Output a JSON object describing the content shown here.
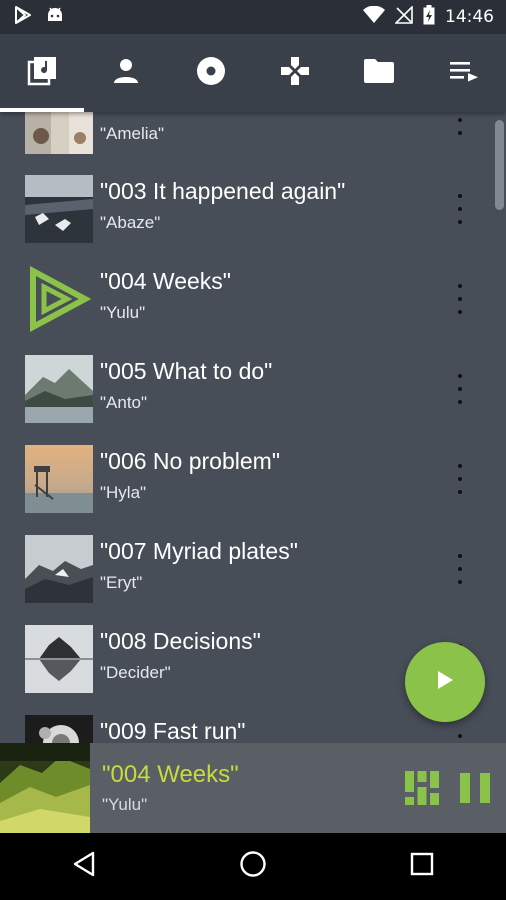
{
  "status_bar": {
    "time": "14:46"
  },
  "tabs": [
    {
      "name": "tracks",
      "icon": "music-library-icon",
      "active": true
    },
    {
      "name": "artists",
      "icon": "person-icon",
      "active": false
    },
    {
      "name": "albums",
      "icon": "disc-icon",
      "active": false
    },
    {
      "name": "genres",
      "icon": "gamepad-icon",
      "active": false
    },
    {
      "name": "folders",
      "icon": "folder-icon",
      "active": false
    },
    {
      "name": "playlists",
      "icon": "playlist-icon",
      "active": false
    }
  ],
  "tracks": [
    {
      "title": "",
      "artist": "\"Amelia\""
    },
    {
      "title": "\"003 It happened again\"",
      "artist": "\"Abaze\""
    },
    {
      "title": "\"004 Weeks\"",
      "artist": "\"Yulu\""
    },
    {
      "title": "\"005 What to do\"",
      "artist": "\"Anto\""
    },
    {
      "title": "\"006 No problem\"",
      "artist": "\"Hyla\""
    },
    {
      "title": "\"007 Myriad plates\"",
      "artist": "\"Eryt\""
    },
    {
      "title": "\"008 Decisions\"",
      "artist": "\"Decider\""
    },
    {
      "title": "\"009 Fast run\"",
      "artist": ""
    }
  ],
  "now_playing": {
    "title": "\"004 Weeks\"",
    "artist": "\"Yulu\""
  },
  "colors": {
    "accent": "#8bc34a",
    "accent_text": "#c4dd3e",
    "background": "#484e58"
  }
}
